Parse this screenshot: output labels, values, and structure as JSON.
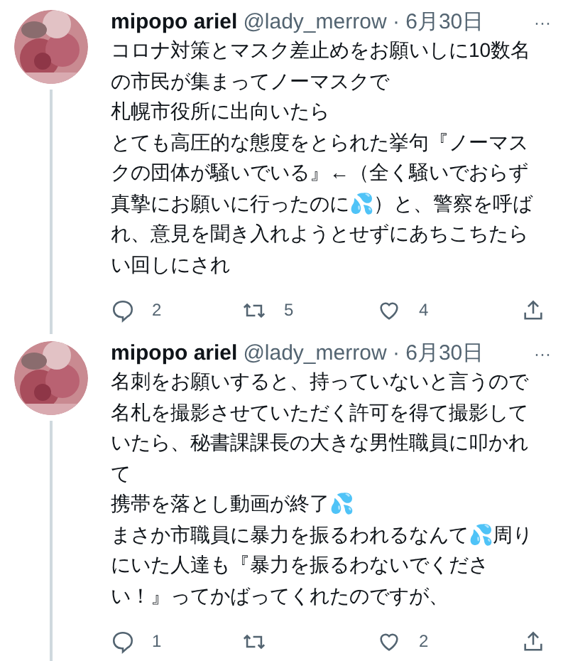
{
  "tweets": [
    {
      "name": "mipopo ariel",
      "handle": "@lady_merrow · 6月30日",
      "more": "···",
      "body": [
        "コロナ対策とマスク差止めをお願いしに10数名の市民が集まってノーマスクで",
        "札幌市役所に出向いたら",
        "とても高圧的な態度をとられた挙句『ノーマスクの団体が騒いでいる』←（全く騒いでおらず真摯にお願いに行ったのに💦）と、警察を呼ばれ、意見を聞き入れようとせずにあちこちたらい回しにされ"
      ],
      "replies": "2",
      "retweets": "5",
      "likes": "4"
    },
    {
      "name": "mipopo ariel",
      "handle": "@lady_merrow · 6月30日",
      "more": "···",
      "body": [
        "名刺をお願いすると、持っていないと言うので名札を撮影させていただく許可を得て撮影していたら、秘書課課長の大きな男性職員に叩かれて",
        "携帯を落とし動画が終了💦",
        "まさか市職員に暴力を振るわれるなんて💦周りにいた人達も『暴力を振るわないでください！』ってかばってくれたのですが、"
      ],
      "replies": "1",
      "likes": "2"
    }
  ]
}
